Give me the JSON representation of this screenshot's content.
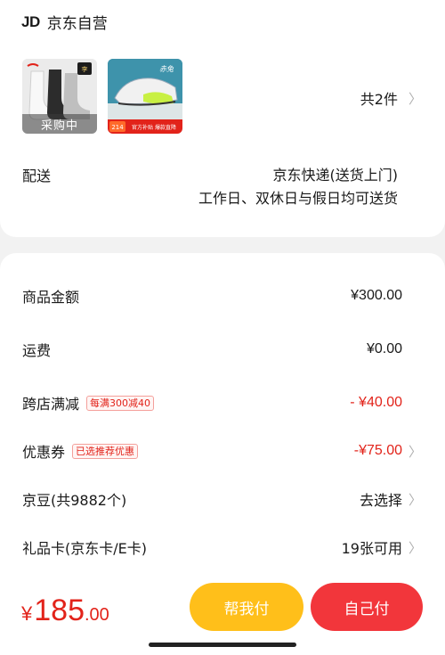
{
  "shop": {
    "logo": "JD",
    "name": "京东自营"
  },
  "products": [
    {
      "name": "socks",
      "overlay": "采购中"
    },
    {
      "name": "shoes",
      "overlay": ""
    }
  ],
  "item_count": "共2件",
  "delivery": {
    "label": "配送",
    "method": "京东快递(送货上门)",
    "note": "工作日、双休日与假日均可送货"
  },
  "summary": {
    "goods_amount": {
      "label": "商品金额",
      "value": "¥300.00"
    },
    "shipping": {
      "label": "运费",
      "value": "¥0.00"
    },
    "cross_store": {
      "label": "跨店满减",
      "tag": "每满300减40",
      "value": "- ¥40.00"
    },
    "coupon": {
      "label": "优惠券",
      "tag": "已选推荐优惠",
      "value": "-¥75.00"
    },
    "jingdou": {
      "label": "京豆(共9882个)",
      "value": "去选择"
    },
    "gift_card": {
      "label": "礼品卡(京东卡/E卡)",
      "value": "19张可用"
    }
  },
  "total": {
    "currency": "¥",
    "integer": "185",
    "decimal": ".00"
  },
  "buttons": {
    "help_pay": "帮我付",
    "self_pay": "自己付"
  },
  "colors": {
    "accent_red": "#e2231a",
    "pay_yellow": "#ffbf1a",
    "pay_red": "#f2363b"
  }
}
